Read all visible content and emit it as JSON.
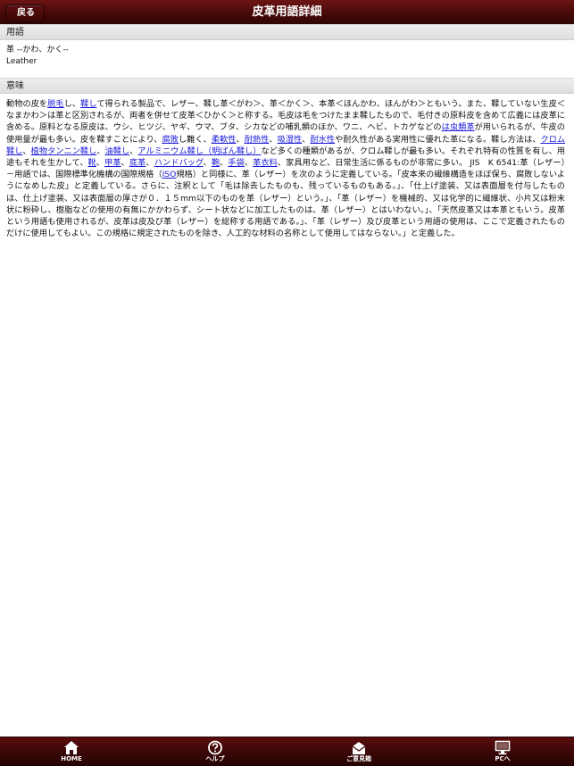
{
  "navbar": {
    "back_label": "戻る",
    "title": "皮革用語詳細"
  },
  "sections": {
    "term_header": "用語",
    "meaning_header": "意味"
  },
  "term": {
    "reading": "革 --かわ、かく--",
    "english": "Leather"
  },
  "meaning": {
    "segments": [
      {
        "t": "動物の皮を"
      },
      {
        "t": "脱毛",
        "link": true
      },
      {
        "t": "し、"
      },
      {
        "t": "鞣し",
        "link": true
      },
      {
        "t": "て得られる製品で、レザー、鞣し革＜がわ＞、革＜かく＞、本革＜ほんかわ、ほんがわ＞ともいう。また、鞣していない生皮＜なまかわ＞は革と区別されるが、両者を併せて皮革＜ひかく＞と称する。毛皮は毛をつけたまま鞣したもので、毛付きの原料皮を含めて広義には皮革に含める。原料となる原皮は、ウシ、ヒツジ、ヤギ、ウマ、ブタ、シカなどの哺乳類のほか、ワニ、ヘビ、トカゲなどの"
      },
      {
        "t": "は虫類革",
        "link": true
      },
      {
        "t": "が用いられるが、牛皮の使用量が最も多い。皮を鞣すことにより、"
      },
      {
        "t": "腐敗",
        "link": true
      },
      {
        "t": "し難く、"
      },
      {
        "t": "柔軟性",
        "link": true
      },
      {
        "t": "、"
      },
      {
        "t": "耐熱性",
        "link": true
      },
      {
        "t": "、"
      },
      {
        "t": "吸湿性",
        "link": true
      },
      {
        "t": "、"
      },
      {
        "t": "耐水性",
        "link": true
      },
      {
        "t": "や耐久性がある実用性に優れた革になる。鞣し方法は、"
      },
      {
        "t": "クロム鞣し",
        "link": true
      },
      {
        "t": "、"
      },
      {
        "t": "植物タンニン鞣し",
        "link": true
      },
      {
        "t": "、"
      },
      {
        "t": "油鞣し",
        "link": true
      },
      {
        "t": "、"
      },
      {
        "t": "アルミニウム鞣し（明ばん鞣し）",
        "link": true
      },
      {
        "t": "など多くの種類があるが、クロム鞣しが最も多い。それぞれ特有の性質を有し、用途もそれを生かして、"
      },
      {
        "t": "靴",
        "link": true
      },
      {
        "t": "、"
      },
      {
        "t": "甲革",
        "link": true
      },
      {
        "t": "、"
      },
      {
        "t": "底革",
        "link": true
      },
      {
        "t": "、"
      },
      {
        "t": "ハンドバッグ",
        "link": true
      },
      {
        "t": "、"
      },
      {
        "t": "鞄",
        "link": true
      },
      {
        "t": "、"
      },
      {
        "t": "手袋",
        "link": true
      },
      {
        "t": "、"
      },
      {
        "t": "革衣料",
        "link": true
      },
      {
        "t": "、家具用など、日常生活に係るものが非常に多い。 JIS　K 6541:革（レザー）－用語では、国際標準化機構の国際規格（"
      },
      {
        "t": "ISO",
        "link": true
      },
      {
        "t": "規格）と同様に、革（レザー）を次のように定義している。「皮本来の繊維構造をほぼ保ち、腐敗しないようになめした皮」と定義している。さらに、注釈として「毛は除去したものも、残っているものもある。」、「仕上げ塗装、又は表面層を付与したものは、仕上げ塗装、又は表面層の厚さが０．１５mm以下のものを革（レザー）という。」、「革（レザー）を機械的、又は化学的に繊維状、小片又は粉末状に粉砕し、樹脂などの使用の有無にかかわらず、シート状などに加工したものは、革（レザー）とはいわない。」、「天然皮革又は本革ともいう。皮革という用語も使用されるが、皮革は皮及び革（レザー）を総称する用語である。」、「革（レザー）及び皮革という用語の使用は、ここで定義されたものだけに使用してもよい。この規格に規定されたものを除き、人工的な材料の名称として使用してはならない。」と定義した。"
      }
    ]
  },
  "tabbar": {
    "items": [
      {
        "label": "HOME",
        "icon": "home-icon"
      },
      {
        "label": "ヘルプ",
        "icon": "help-icon"
      },
      {
        "label": "ご意見箱",
        "icon": "mail-icon"
      },
      {
        "label": "PCへ",
        "icon": "monitor-icon"
      }
    ]
  },
  "colors": {
    "bar_dark": "#3c0707",
    "link": "#1a1adb"
  }
}
